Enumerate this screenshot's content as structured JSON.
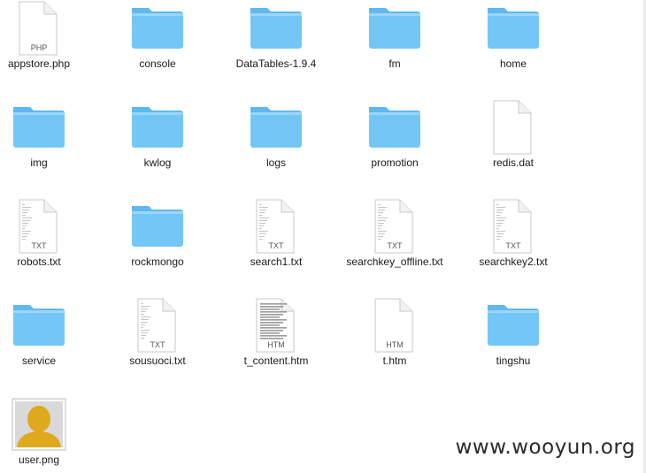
{
  "files": [
    {
      "name": "appstore.php",
      "kind": "document",
      "badge": "PHP"
    },
    {
      "name": "console",
      "kind": "folder"
    },
    {
      "name": "DataTables-1.9.4",
      "kind": "folder"
    },
    {
      "name": "fm",
      "kind": "folder"
    },
    {
      "name": "home",
      "kind": "folder"
    },
    {
      "name": "img",
      "kind": "folder"
    },
    {
      "name": "kwlog",
      "kind": "folder"
    },
    {
      "name": "logs",
      "kind": "folder"
    },
    {
      "name": "promotion",
      "kind": "folder"
    },
    {
      "name": "redis.dat",
      "kind": "document",
      "badge": ""
    },
    {
      "name": "robots.txt",
      "kind": "document",
      "badge": "TXT"
    },
    {
      "name": "rockmongo",
      "kind": "folder"
    },
    {
      "name": "search1.txt",
      "kind": "document",
      "badge": "TXT"
    },
    {
      "name": "searchkey_offline.txt",
      "kind": "document",
      "badge": "TXT"
    },
    {
      "name": "searchkey2.txt",
      "kind": "document",
      "badge": "TXT"
    },
    {
      "name": "service",
      "kind": "folder"
    },
    {
      "name": "sousuoci.txt",
      "kind": "document",
      "badge": "TXT"
    },
    {
      "name": "t_content.htm",
      "kind": "document",
      "badge": "HTM"
    },
    {
      "name": "t.htm",
      "kind": "document",
      "badge": "HTM"
    },
    {
      "name": "tingshu",
      "kind": "folder"
    },
    {
      "name": "user.png",
      "kind": "image"
    }
  ],
  "watermark": "www.wooyun.org",
  "colors": {
    "folder_body": "#74c6f7",
    "folder_tab": "#5fb8ef",
    "page_fill": "#ffffff",
    "page_stroke": "#c9c9c9",
    "avatar_gold": "#e0a81c"
  }
}
